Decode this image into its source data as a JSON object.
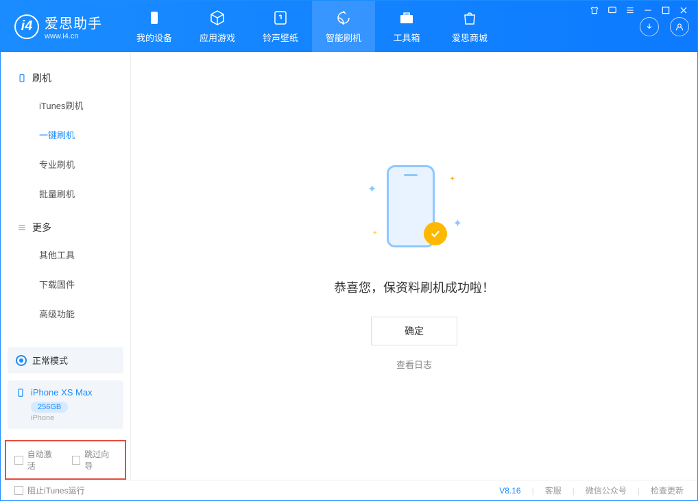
{
  "app": {
    "title": "爱思助手",
    "url": "www.i4.cn"
  },
  "nav": [
    {
      "label": "我的设备"
    },
    {
      "label": "应用游戏"
    },
    {
      "label": "铃声壁纸"
    },
    {
      "label": "智能刷机"
    },
    {
      "label": "工具箱"
    },
    {
      "label": "爱思商城"
    }
  ],
  "sidebar": {
    "group1_title": "刷机",
    "group1": [
      {
        "label": "iTunes刷机"
      },
      {
        "label": "一键刷机"
      },
      {
        "label": "专业刷机"
      },
      {
        "label": "批量刷机"
      }
    ],
    "group2_title": "更多",
    "group2": [
      {
        "label": "其他工具"
      },
      {
        "label": "下载固件"
      },
      {
        "label": "高级功能"
      }
    ]
  },
  "device": {
    "mode": "正常模式",
    "name": "iPhone XS Max",
    "storage": "256GB",
    "type": "iPhone"
  },
  "checkboxes": {
    "auto_activate": "自动激活",
    "skip_guide": "跳过向导"
  },
  "main": {
    "message": "恭喜您，保资料刷机成功啦！",
    "ok_button": "确定",
    "log_link": "查看日志"
  },
  "footer": {
    "block_itunes": "阻止iTunes运行",
    "version": "V8.16",
    "support": "客服",
    "wechat": "微信公众号",
    "update": "检查更新"
  }
}
